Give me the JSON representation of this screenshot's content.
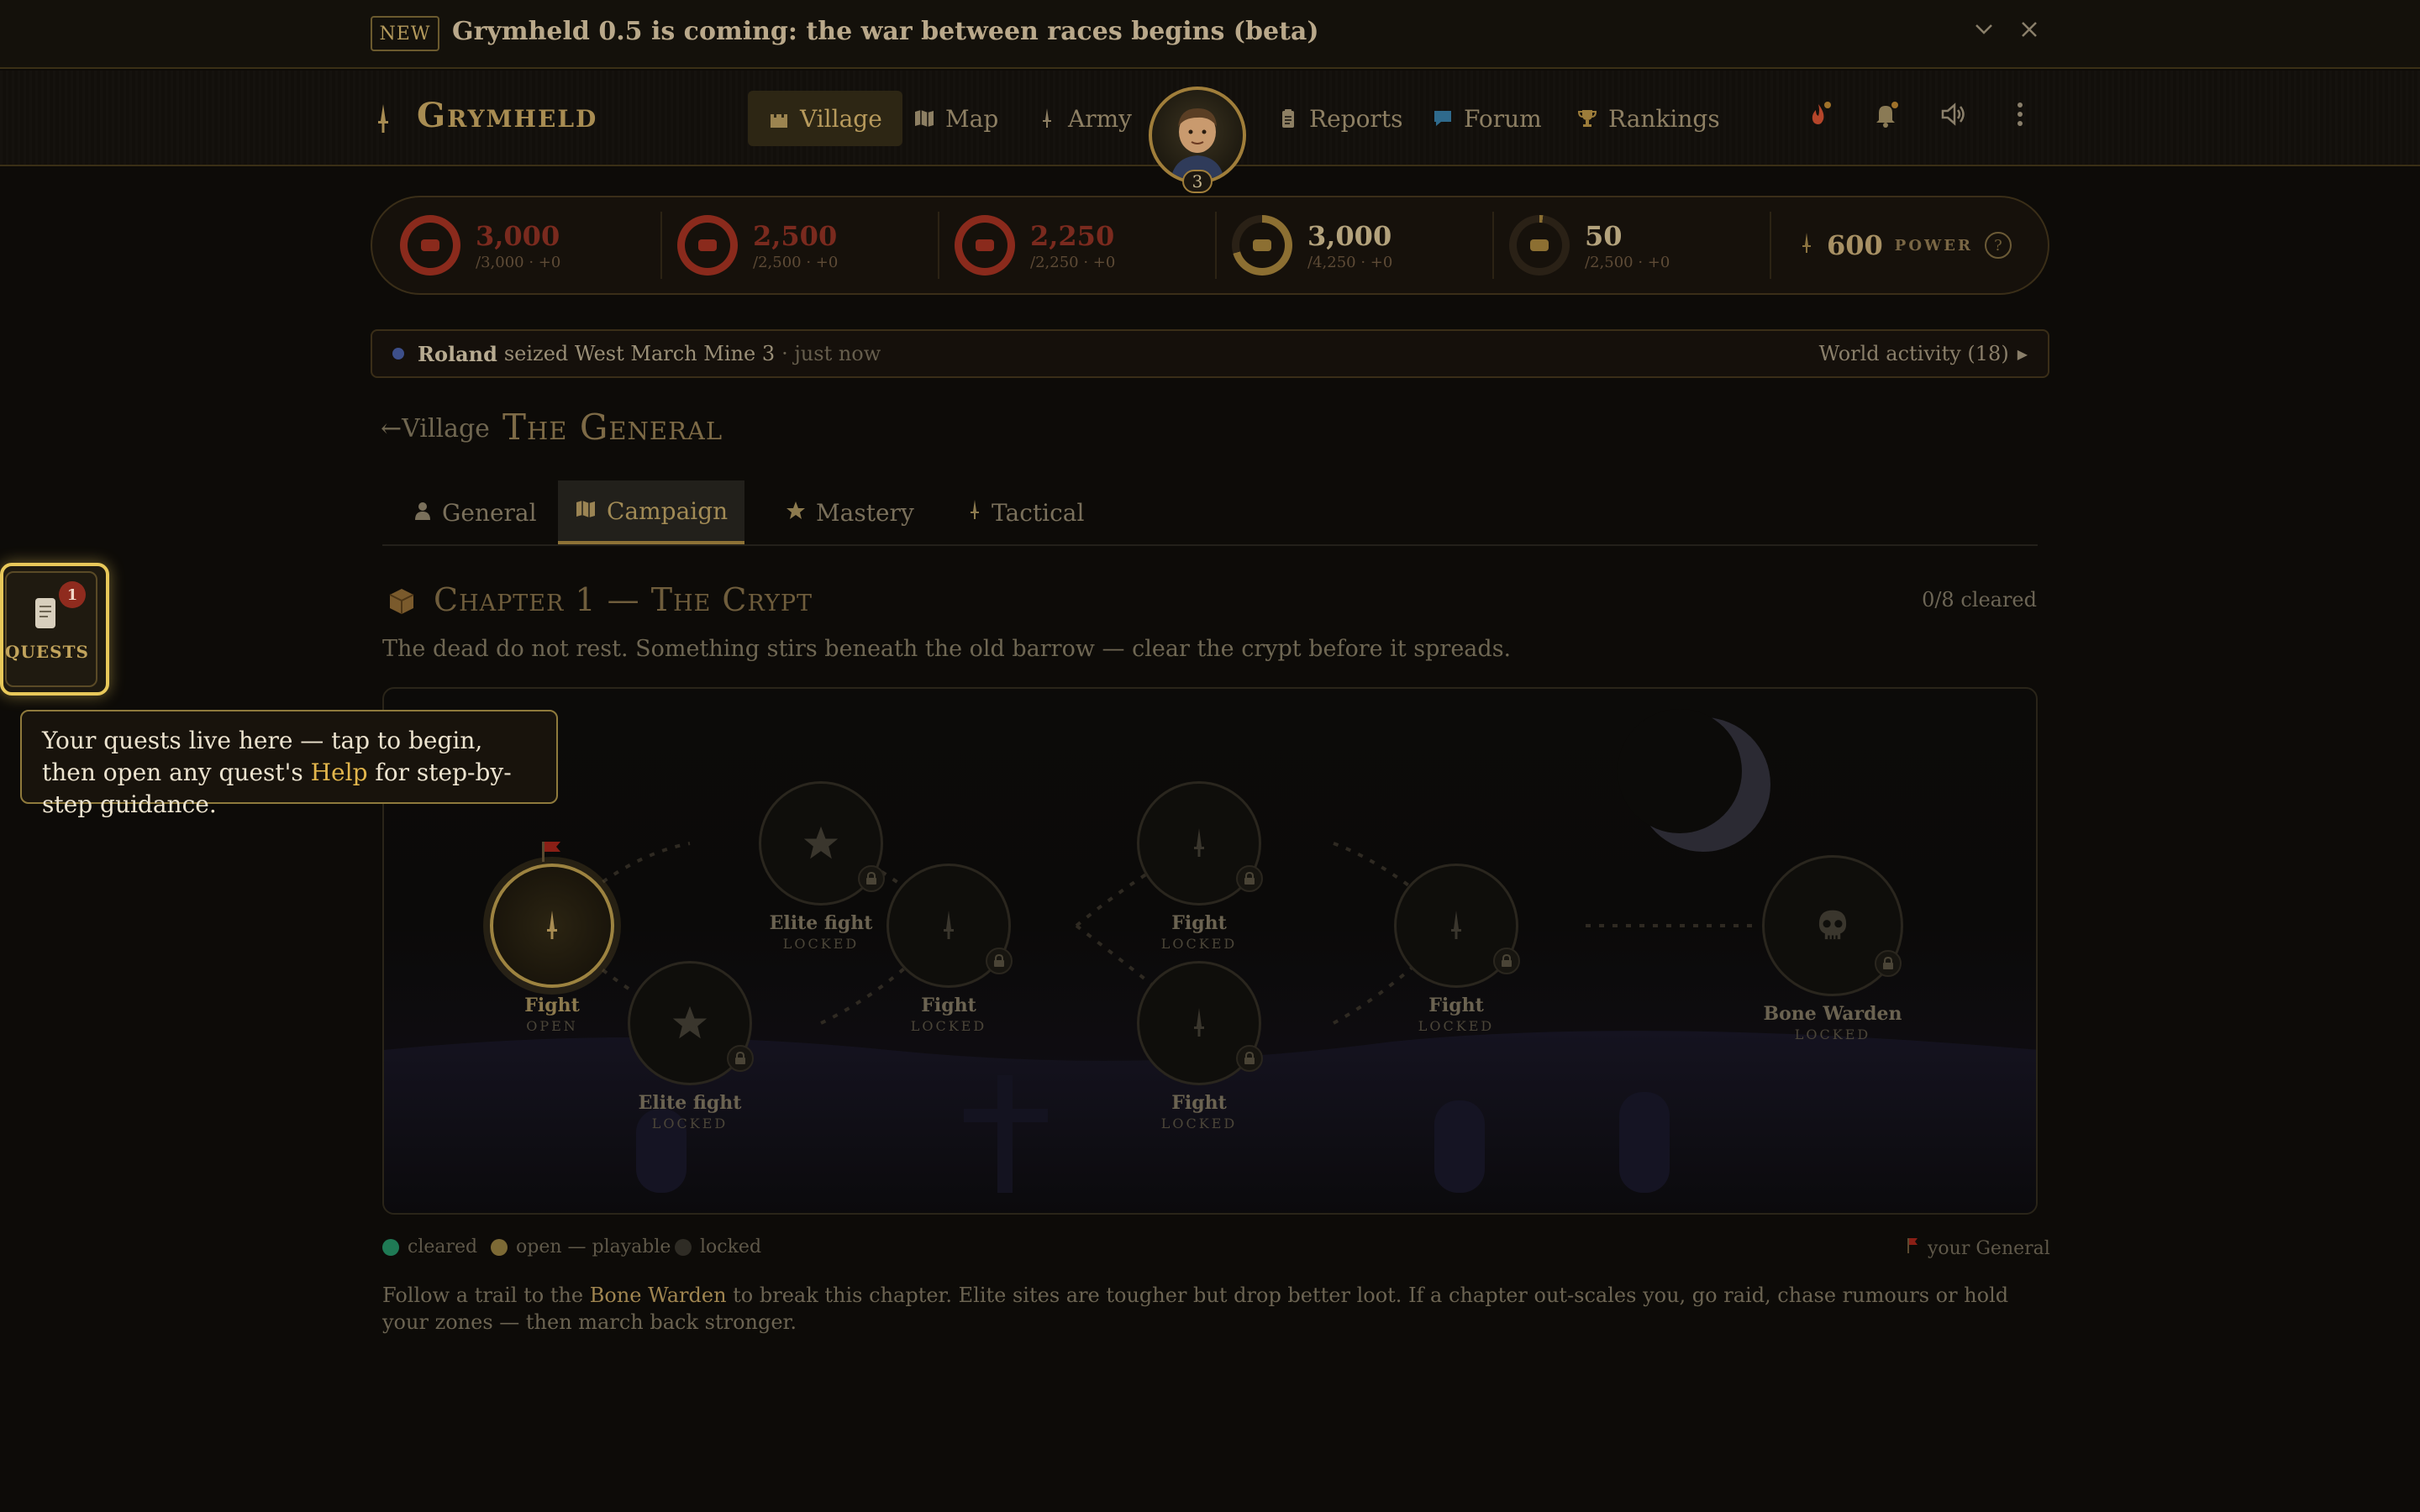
{
  "announcement": {
    "badge": "NEW",
    "message": "Grymheld 0.5 is coming: the war between races begins (beta)"
  },
  "header": {
    "logo": "Grymheld",
    "nav": [
      {
        "label": "Village",
        "icon": "castle-icon",
        "active": true
      },
      {
        "label": "Map",
        "icon": "map-icon",
        "active": false
      },
      {
        "label": "Army",
        "icon": "sword-icon",
        "active": false
      },
      {
        "label": "Reports",
        "icon": "clipboard-icon",
        "active": false
      },
      {
        "label": "Forum",
        "icon": "speech-bubble-icon",
        "active": false
      },
      {
        "label": "Rankings",
        "icon": "trophy-icon",
        "active": false
      }
    ],
    "avatar_level": "3"
  },
  "resources": [
    {
      "value": "3,000",
      "sub": "/3,000 · +0",
      "icon": "log-icon",
      "color": "#8a2a1c",
      "fill": 1.0
    },
    {
      "value": "2,500",
      "sub": "/2,500 · +0",
      "icon": "stone-icon",
      "color": "#8a2a1c",
      "fill": 1.0
    },
    {
      "value": "2,250",
      "sub": "/2,250 · +0",
      "icon": "iron-icon",
      "color": "#8a2a1c",
      "fill": 1.0
    },
    {
      "value": "3,000",
      "sub": "/4,250 · +0",
      "icon": "wheat-icon",
      "color": "#8c6f32",
      "fill": 0.706
    },
    {
      "value": "50",
      "sub": "/2,500 · +0",
      "icon": "gold-icon",
      "color": "#8c6f32",
      "fill": 0.02
    }
  ],
  "power": {
    "value": "600",
    "label": "POWER",
    "help": "?"
  },
  "activity": {
    "actor": "Roland",
    "text": "seized West March Mine 3",
    "time": "· just now",
    "link": "World activity (18)"
  },
  "breadcrumb": {
    "back": "Village",
    "title": "The General"
  },
  "tabs": [
    {
      "label": "General",
      "icon": "person-icon",
      "active": false
    },
    {
      "label": "Campaign",
      "icon": "map-icon",
      "active": true
    },
    {
      "label": "Mastery",
      "icon": "star-icon",
      "active": false
    },
    {
      "label": "Tactical",
      "icon": "sword-icon",
      "active": false
    }
  ],
  "chapter": {
    "title": "Chapter 1 — The Crypt",
    "count": "0/8 cleared",
    "description": "The dead do not rest. Something stirs beneath the old barrow — clear the crypt before it spreads."
  },
  "nodes": [
    {
      "name": "Fight",
      "status": "OPEN",
      "icon": "sword-icon"
    },
    {
      "name": "Elite fight",
      "status": "LOCKED",
      "icon": "star-icon"
    },
    {
      "name": "Fight",
      "status": "LOCKED",
      "icon": "sword-icon"
    },
    {
      "name": "Fight",
      "status": "LOCKED",
      "icon": "sword-icon"
    },
    {
      "name": "Fight",
      "status": "LOCKED",
      "icon": "sword-icon"
    },
    {
      "name": "Elite fight",
      "status": "LOCKED",
      "icon": "star-icon"
    },
    {
      "name": "Fight",
      "status": "LOCKED",
      "icon": "sword-icon"
    },
    {
      "name": "Bone Warden",
      "status": "LOCKED",
      "icon": "skull-icon"
    }
  ],
  "legend": {
    "cleared": "cleared",
    "open": "open — playable",
    "locked": "locked",
    "general": "your General",
    "colors": {
      "cleared": "#1f7a55",
      "open": "#7d6a35",
      "locked": "#2f2c25",
      "general": "#8a1f16"
    }
  },
  "footer": {
    "before": "Follow a trail to the ",
    "highlight": "Bone Warden",
    "after": " to break this chapter. Elite sites are tougher but drop better loot. If a chapter out-scales you, go raid, chase rumours or hold your zones — then march back stronger."
  },
  "quests": {
    "label": "QUESTS",
    "badge": "1"
  },
  "tooltip": {
    "before": "Your quests live here — tap to begin, then open any quest's ",
    "help": "Help",
    "after": " for step-by-step guidance."
  }
}
